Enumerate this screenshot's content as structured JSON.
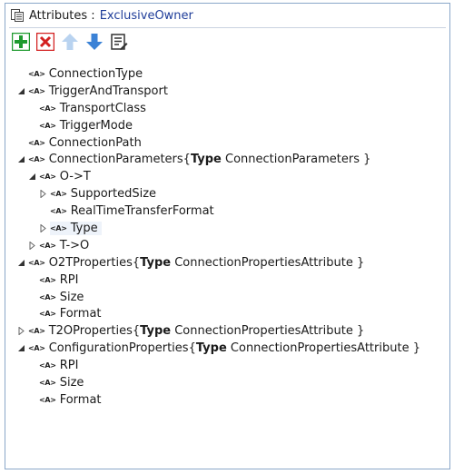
{
  "header": {
    "label": "Attributes :",
    "name": "ExclusiveOwner",
    "icon": "attributes-icon"
  },
  "toolbar": {
    "buttons": [
      {
        "name": "add-icon",
        "tooltip": "",
        "color": "#1e9a2e"
      },
      {
        "name": "delete-icon",
        "tooltip": "",
        "color": "#d32020"
      },
      {
        "name": "move-up-icon",
        "color": "#b9d3f0"
      },
      {
        "name": "move-down-icon",
        "color": "#3b82d6"
      },
      {
        "name": "properties-icon",
        "color": "#333333"
      }
    ]
  },
  "tree": {
    "attr_badge": "<A>",
    "type_keyword": "Type",
    "rows": [
      {
        "label": "ConnectionType",
        "level": 0,
        "expander": "none"
      },
      {
        "label": "TriggerAndTransport",
        "level": 0,
        "expander": "expanded"
      },
      {
        "label": "TransportClass",
        "level": 1,
        "expander": "none"
      },
      {
        "label": "TriggerMode",
        "level": 1,
        "expander": "none"
      },
      {
        "label": "ConnectionPath",
        "level": 0,
        "expander": "none"
      },
      {
        "label": "ConnectionParameters",
        "level": 0,
        "expander": "expanded",
        "type_open": "{",
        "type_name": "ConnectionParameters",
        "type_close": "}"
      },
      {
        "label": "O->T",
        "level": 1,
        "expander": "expanded"
      },
      {
        "label": "SupportedSize",
        "level": 2,
        "expander": "collapsed"
      },
      {
        "label": "RealTimeTransferFormat",
        "level": 2,
        "expander": "none"
      },
      {
        "label": "Type",
        "level": 2,
        "expander": "collapsed",
        "hover": true
      },
      {
        "label": "T->O",
        "level": 1,
        "expander": "collapsed"
      },
      {
        "label": "O2TProperties",
        "level": 0,
        "expander": "expanded",
        "type_open": "{",
        "type_name": "ConnectionPropertiesAttribute",
        "type_close": "}"
      },
      {
        "label": "RPI",
        "level": 1,
        "expander": "none"
      },
      {
        "label": "Size",
        "level": 1,
        "expander": "none"
      },
      {
        "label": "Format",
        "level": 1,
        "expander": "none"
      },
      {
        "label": "T2OProperties",
        "level": 0,
        "expander": "collapsed",
        "type_open": "{",
        "type_name": "ConnectionPropertiesAttribute",
        "type_close": "}"
      },
      {
        "label": "ConfigurationProperties",
        "level": 0,
        "expander": "expanded",
        "type_open": "{",
        "type_name": "ConnectionPropertiesAttribute",
        "type_close": "}"
      },
      {
        "label": "RPI",
        "level": 1,
        "expander": "none"
      },
      {
        "label": "Size",
        "level": 1,
        "expander": "none"
      },
      {
        "label": "Format",
        "level": 1,
        "expander": "none"
      }
    ]
  }
}
